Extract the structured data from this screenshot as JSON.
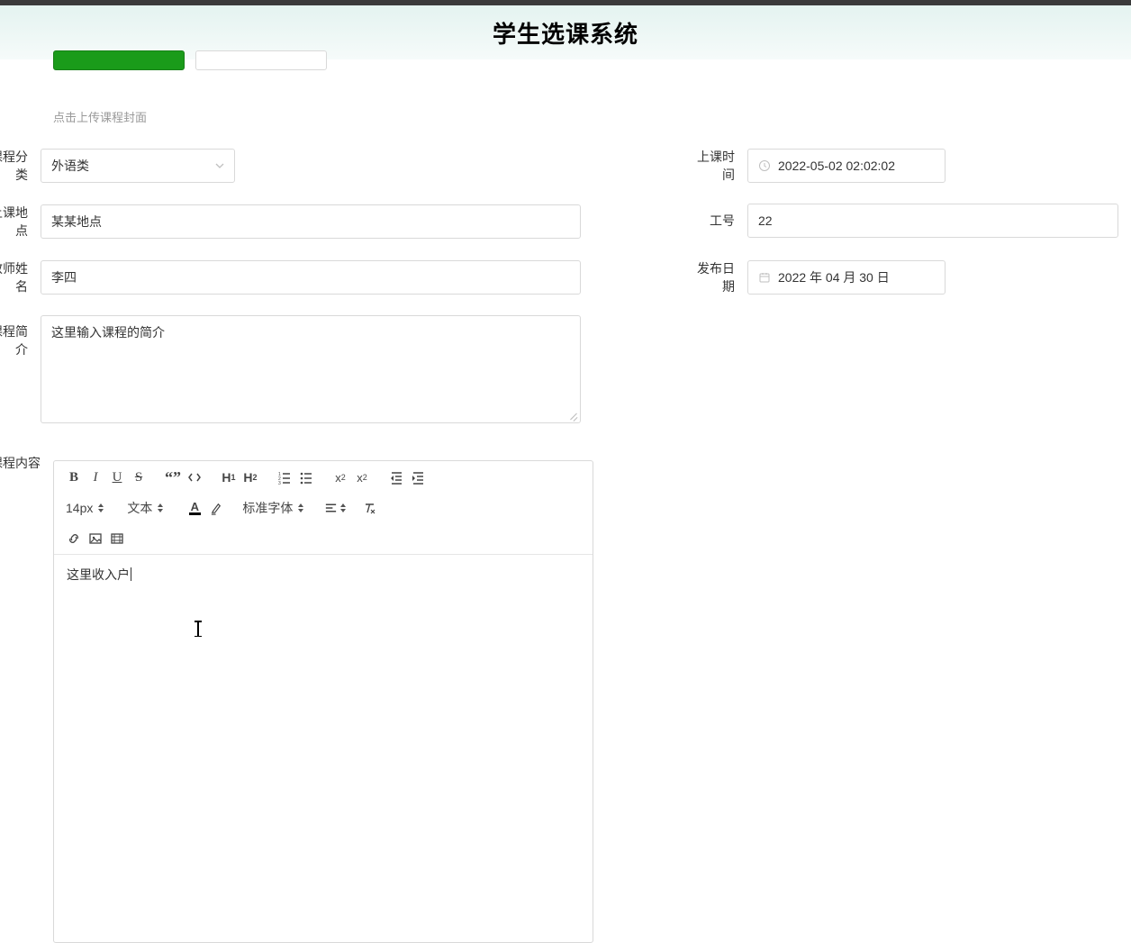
{
  "header": {
    "title": "学生选课系统"
  },
  "uploadHint": "点击上传课程封面",
  "labels": {
    "category": "课程分类",
    "classTime": "上课时间",
    "classPlace": "上课地点",
    "workNo": "工号",
    "teacherName": "教师姓名",
    "publishDate": "发布日期",
    "brief": "课程简介",
    "content": "课程内容"
  },
  "form": {
    "category": "外语类",
    "classTime": "2022-05-02 02:02:02",
    "classPlace": "某某地点",
    "workNo": "22",
    "teacherName": "李四",
    "publishDate": "2022 年 04 月 30 日",
    "brief": "这里输入课程的简介",
    "content": "这里收入户"
  },
  "editorToolbar": {
    "sizeLabel": "14px",
    "blockLabel": "文本",
    "fontLabel": "标准字体"
  }
}
